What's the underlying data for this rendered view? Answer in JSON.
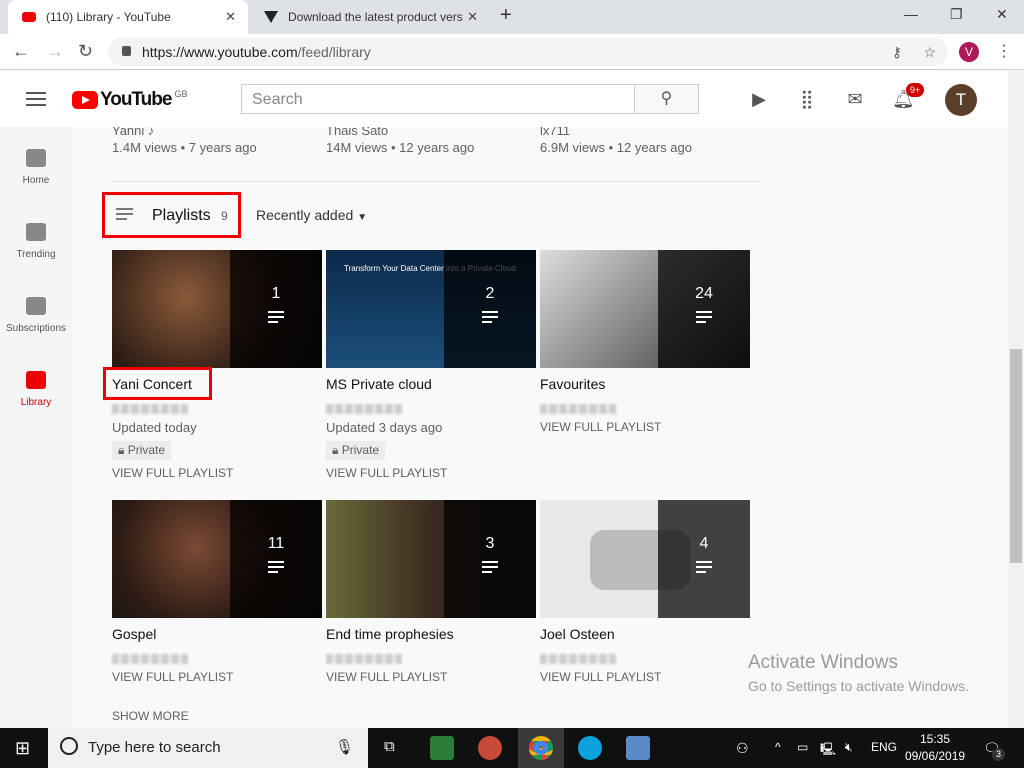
{
  "browser": {
    "tabs": [
      {
        "title": "(110) Library - YouTube",
        "active": true
      },
      {
        "title": "Download the latest product vers",
        "active": false
      }
    ],
    "url_host": "https://www.youtube.com",
    "url_path": "/feed/library",
    "profile_initial": "V"
  },
  "header": {
    "logo_text": "YouTube",
    "region": "GB",
    "search_placeholder": "Search",
    "notification_count": "9+",
    "avatar_initial": "T"
  },
  "sidebar": {
    "items": [
      {
        "label": "Home",
        "icon": "home-icon"
      },
      {
        "label": "Trending",
        "icon": "flame-icon"
      },
      {
        "label": "Subscriptions",
        "icon": "subscriptions-icon"
      },
      {
        "label": "Library",
        "icon": "folder-icon",
        "selected": true
      }
    ]
  },
  "prev_videos": [
    {
      "channel": "Yanni ♪",
      "meta": "1.4M views • 7 years ago"
    },
    {
      "channel": "Thais Sato",
      "meta": "14M views • 12 years ago"
    },
    {
      "channel": "lx711",
      "meta": "6.9M views • 12 years ago"
    }
  ],
  "playlists_section": {
    "title": "Playlists",
    "count": "9",
    "sort": "Recently added",
    "show_more": "SHOW MORE",
    "items": [
      {
        "title": "Yani Concert",
        "count": "1",
        "updated": "Updated today",
        "privacy": "Private",
        "action": "VIEW FULL PLAYLIST"
      },
      {
        "title": "MS Private cloud",
        "count": "2",
        "updated": "Updated 3 days ago",
        "privacy": "Private",
        "action": "VIEW FULL PLAYLIST",
        "thumb_text": "Transform Your Data Center into a Private Cloud"
      },
      {
        "title": "Favourites",
        "count": "24",
        "action": "VIEW FULL PLAYLIST"
      },
      {
        "title": "Gospel",
        "count": "11",
        "action": "VIEW FULL PLAYLIST"
      },
      {
        "title": "End time prophesies",
        "count": "3",
        "action": "VIEW FULL PLAYLIST"
      },
      {
        "title": "Joel Osteen",
        "count": "4",
        "action": "VIEW FULL PLAYLIST"
      }
    ]
  },
  "watermark": {
    "title": "Activate Windows",
    "subtitle": "Go to Settings to activate Windows."
  },
  "taskbar": {
    "search_placeholder": "Type here to search",
    "language": "ENG",
    "time": "15:35",
    "date": "09/06/2019",
    "notifications": "3"
  },
  "colors": {
    "youtube_red": "#ff0000",
    "highlight_box": "#e00000"
  }
}
